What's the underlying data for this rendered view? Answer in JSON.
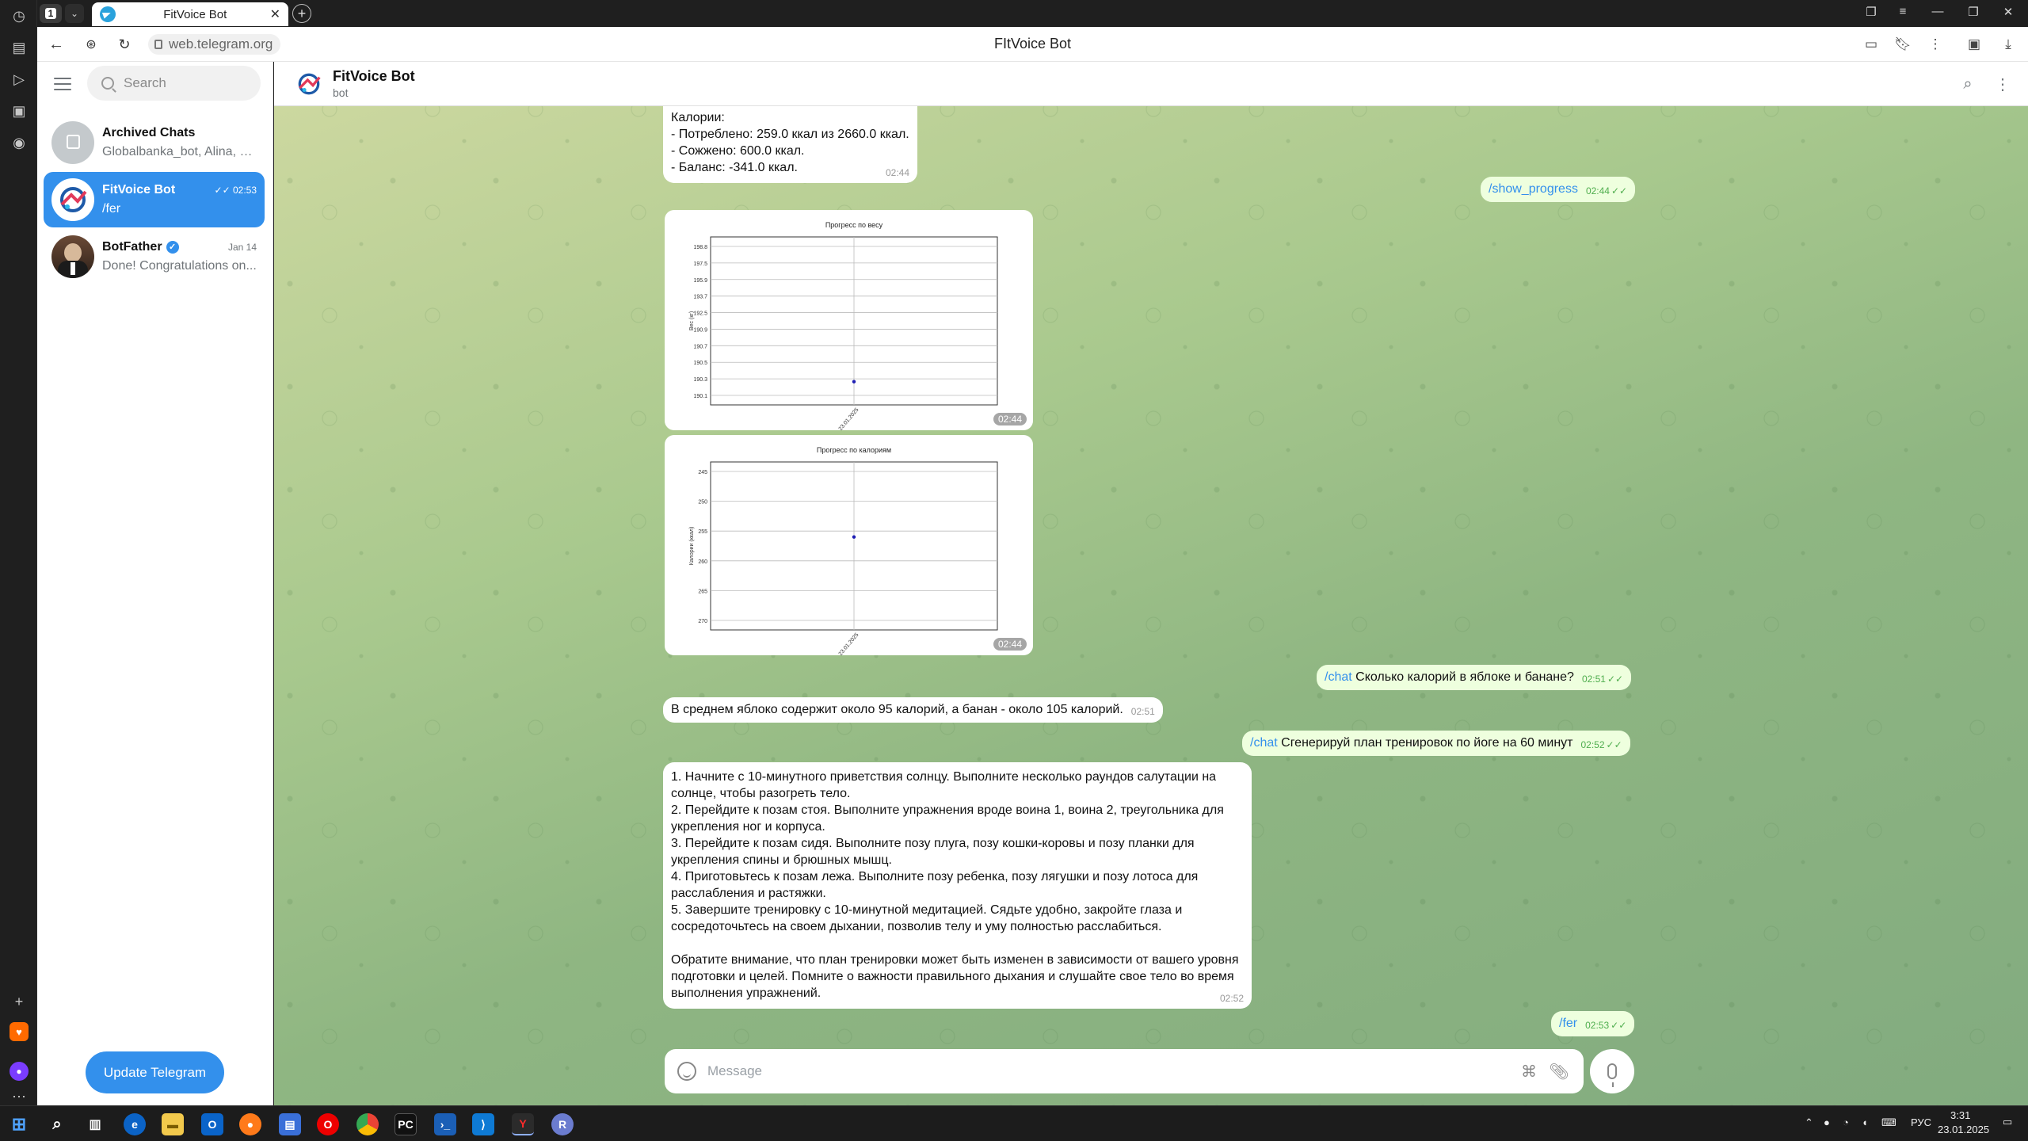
{
  "browser": {
    "tab_count": "1",
    "tab_title": "FitVoice Bot",
    "url": "web.telegram.org",
    "page_title": "FItVoice Bot"
  },
  "sidebar": {
    "search_placeholder": "Search",
    "chats": [
      {
        "name": "Archived Chats",
        "preview": "Globalbanka_bot, Alina, V...",
        "time": ""
      },
      {
        "name": "FitVoice Bot",
        "preview": "/fer",
        "time": "02:53"
      },
      {
        "name": "BotFather",
        "preview": "Done! Congratulations on...",
        "time": "Jan 14"
      }
    ],
    "update_button": "Update Telegram"
  },
  "chat_header": {
    "name": "FitVoice Bot",
    "status": "bot"
  },
  "messages": {
    "m1": {
      "lines": [
        "Калории:",
        "- Потреблено: 259.0 ккал из 2660.0 ккал.",
        "- Сожжено: 600.0 ккал.",
        "- Баланс: -341.0 ккал."
      ],
      "time": "02:44"
    },
    "m2": {
      "cmd": "/show_progress",
      "text": "",
      "time": "02:44"
    },
    "m3": {
      "time": "02:44",
      "chart_ref": 0
    },
    "m4": {
      "time": "02:44",
      "chart_ref": 1
    },
    "m5": {
      "cmd": "/chat",
      "text": " Сколько калорий в яблоке и банане?",
      "time": "02:51"
    },
    "m6": {
      "text": "В среднем яблоко содержит около 95 калорий, а банан - около 105 калорий.",
      "time": "02:51"
    },
    "m7": {
      "cmd": "/chat",
      "text": " Сгенерируй план тренировок по йоге на 60 минут",
      "time": "02:52"
    },
    "m8": {
      "lines": [
        "1. Начните с 10-минутного приветствия солнцу. Выполните несколько раундов салутации на солнце, чтобы разогреть тело.",
        "2. Перейдите к позам стоя. Выполните упражнения вроде воина 1, воина 2, треугольника для укрепления ног и корпуса.",
        "3. Перейдите к позам сидя. Выполните позу плуга, позу кошки-коровы и позу планки для укрепления спины и брюшных мышц.",
        "4. Приготовьтесь к позам лежа. Выполните позу ребенка, позу лягушки и позу лотоса для расслабления и растяжки.",
        "5. Завершите тренировку с 10-минутной медитацией. Сядьте удобно, закройте глаза и сосредоточьтесь на своем дыхании, позволив телу и уму полностью расслабиться.",
        "",
        "Обратите внимание, что план тренировки может быть изменен в зависимости от вашего уровня подготовки и целей. Помните о важности правильного дыхания и слушайте свое тело во время выполнения упражнений."
      ],
      "time": "02:52"
    },
    "m9": {
      "cmd": "/fer",
      "text": "",
      "time": "02:53"
    }
  },
  "composer": {
    "placeholder": "Message"
  },
  "taskbar": {
    "lang": "РУС",
    "clock_time": "3:31",
    "clock_date": "23.01.2025"
  },
  "chart_data": [
    {
      "type": "scatter",
      "title": "Прогресс по весу",
      "ylabel": "Вес (кг)",
      "xlabel": "",
      "yticks": [
        "190.1",
        "190.3",
        "190.5",
        "190.7",
        "190.9",
        "192.5",
        "193.7",
        "195.9",
        "197.5",
        "198.8"
      ],
      "x": [
        "23.01.2025"
      ],
      "y": [
        190.9
      ],
      "color": "#1f1fb4",
      "grid": true
    },
    {
      "type": "scatter",
      "title": "Прогресс по калориям",
      "ylabel": "Калории (ккал)",
      "xlabel": "",
      "yticks": [
        "270",
        "265",
        "260",
        "255",
        "250",
        "245"
      ],
      "x": [
        "23.01.2025"
      ],
      "y": [
        259
      ],
      "color": "#1f1fb4",
      "grid": true
    }
  ],
  "colors": {
    "accent": "#3390ec",
    "outgoing": "#eeffde",
    "check": "#4fae4e"
  }
}
